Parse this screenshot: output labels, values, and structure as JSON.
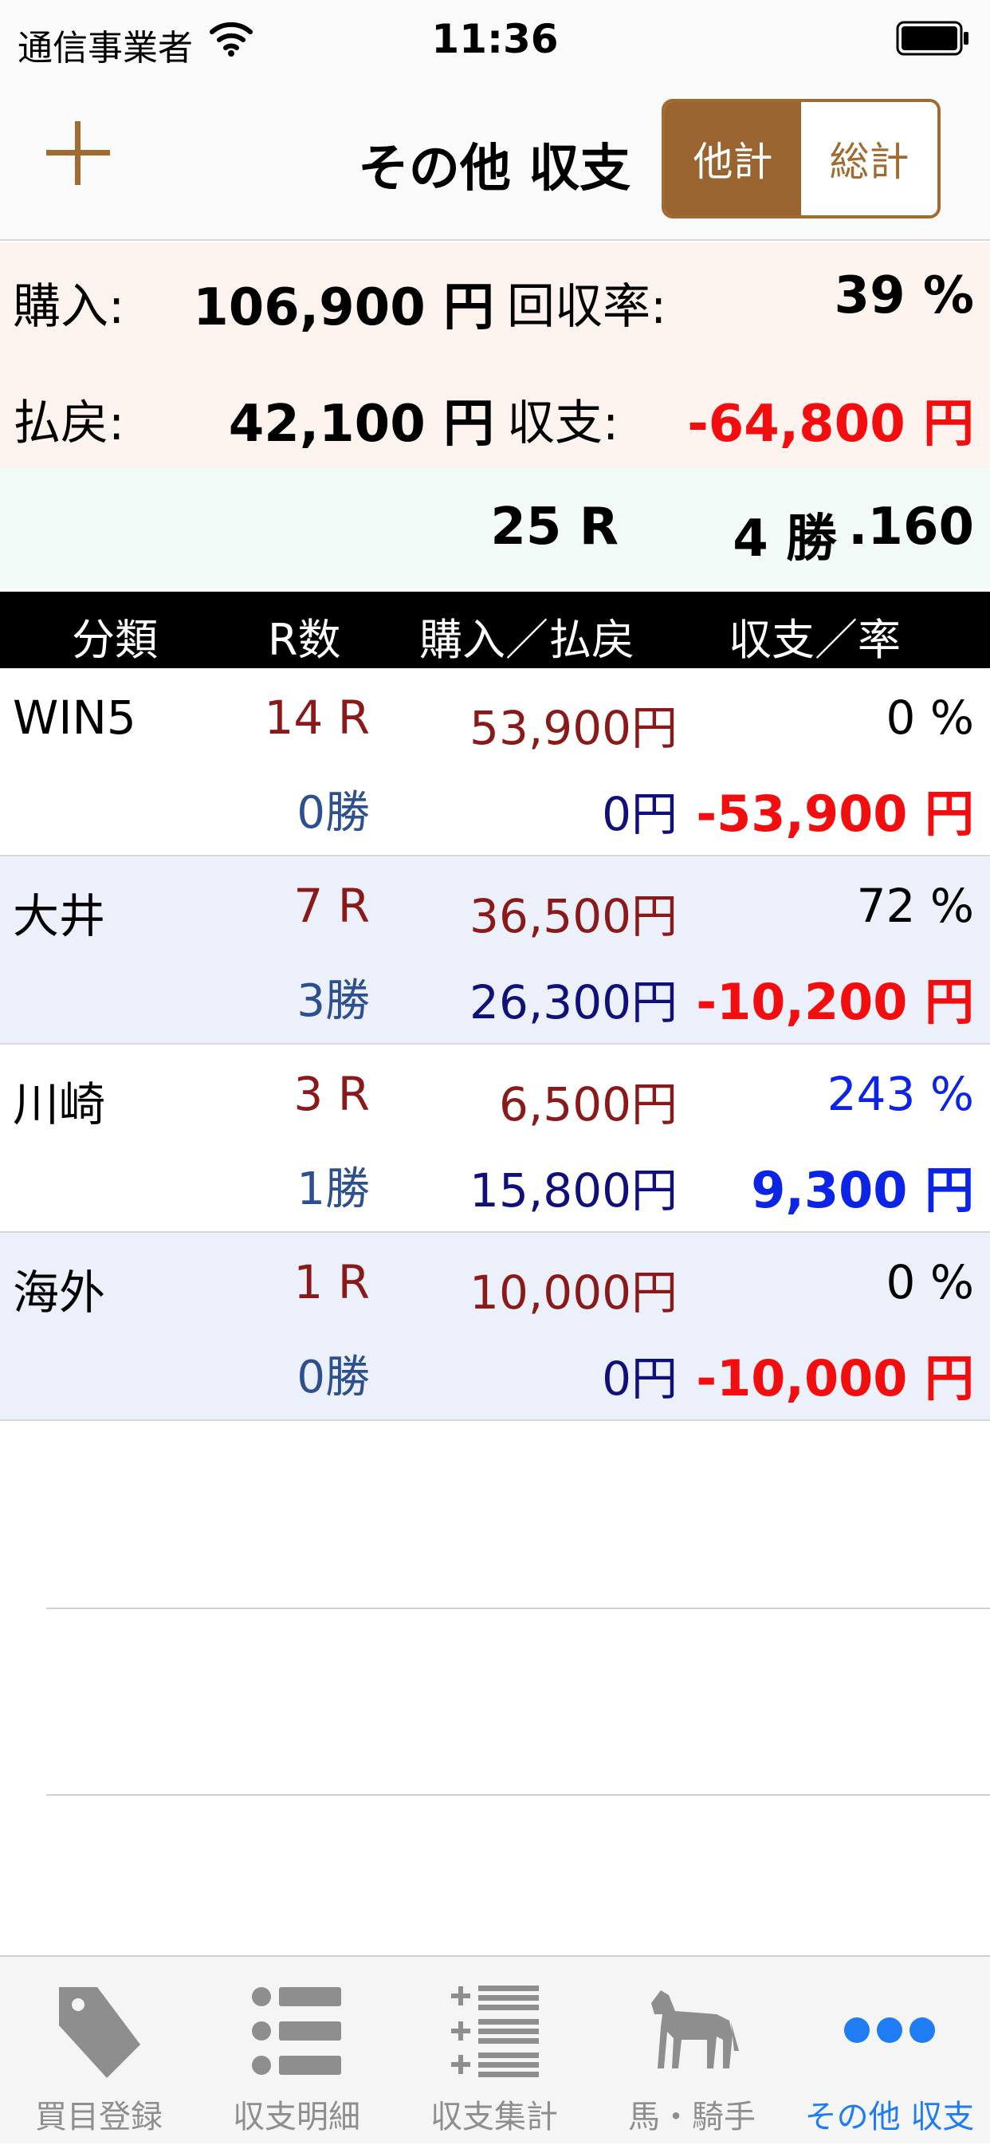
{
  "status_bar": {
    "carrier": "通信事業者",
    "time": "11:36"
  },
  "nav": {
    "title": "その他 収支",
    "segments": [
      {
        "label": "他計",
        "selected": true
      },
      {
        "label": "総計",
        "selected": false
      }
    ],
    "accent_color": "#a06a30"
  },
  "summary": {
    "purchase_label": "購入:",
    "purchase_value": "106,900 円",
    "return_rate_label": "回収率:",
    "return_rate_value": "39 %",
    "payout_label": "払戻:",
    "payout_value": "42,100 円",
    "balance_label": "収支:",
    "balance_value": "-64,800 円",
    "races": "25 R",
    "wins": "4 勝",
    "win_rate": ".160"
  },
  "table": {
    "headers": [
      "分類",
      "R数",
      "購入／払戻",
      "収支／率"
    ],
    "rows": [
      {
        "category": "WIN5",
        "races": "14 R",
        "wins": "0勝",
        "purchase": "53,900円",
        "payout": "0円",
        "rate": "0 %",
        "balance": "-53,900 円",
        "positive": false
      },
      {
        "category": "大井",
        "races": "7 R",
        "wins": "3勝",
        "purchase": "36,500円",
        "payout": "26,300円",
        "rate": "72 %",
        "balance": "-10,200 円",
        "positive": false
      },
      {
        "category": "川崎",
        "races": "3 R",
        "wins": "1勝",
        "purchase": "6,500円",
        "payout": "15,800円",
        "rate": "243 %",
        "balance": "9,300 円",
        "positive": true
      },
      {
        "category": "海外",
        "races": "1 R",
        "wins": "0勝",
        "purchase": "10,000円",
        "payout": "0円",
        "rate": "0 %",
        "balance": "-10,000 円",
        "positive": false
      }
    ]
  },
  "tabs": [
    {
      "label": "買目登録",
      "icon": "tag-icon",
      "active": false
    },
    {
      "label": "収支明細",
      "icon": "list-icon",
      "active": false
    },
    {
      "label": "収支集計",
      "icon": "plus-list-icon",
      "active": false
    },
    {
      "label": "馬・騎手",
      "icon": "horse-icon",
      "active": false
    },
    {
      "label": "その他 収支",
      "icon": "more-icon",
      "active": true
    }
  ]
}
